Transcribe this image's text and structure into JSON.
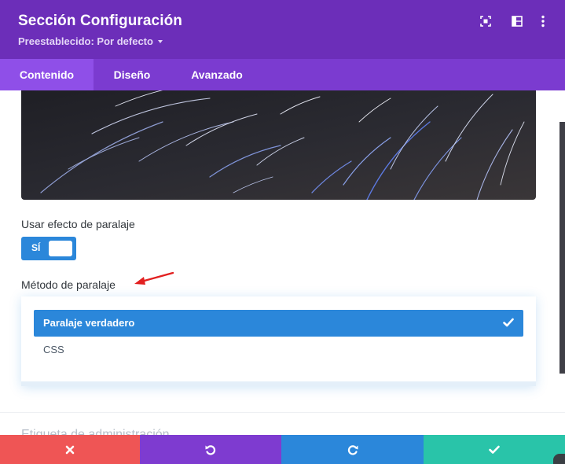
{
  "header": {
    "title": "Sección Configuración",
    "preset_label": "Preestablecido: Por defecto",
    "icons": [
      "focus-icon",
      "columns-icon",
      "more-vertical-icon"
    ]
  },
  "tabs": [
    {
      "label": "Contenido",
      "active": true
    },
    {
      "label": "Diseño",
      "active": false
    },
    {
      "label": "Avanzado",
      "active": false
    }
  ],
  "content": {
    "parallax_label": "Usar efecto de paralaje",
    "parallax_toggle": {
      "state_label": "SÍ",
      "on": true
    },
    "method_label": "Método de paralaje",
    "method_options": [
      {
        "label": "Paralaje verdadero",
        "selected": true
      },
      {
        "label": "CSS",
        "selected": false
      }
    ],
    "next_section_label": "Etiqueta de administración"
  },
  "footer": {
    "buttons": [
      {
        "icon": "close-icon",
        "color": "#ef5555"
      },
      {
        "icon": "undo-icon",
        "color": "#7e3bd0"
      },
      {
        "icon": "redo-icon",
        "color": "#2b87da"
      },
      {
        "icon": "check-icon",
        "color": "#29c4a9"
      }
    ]
  },
  "colors": {
    "header": "#6c2eb9",
    "tabs": "#7b3bd0",
    "active_tab": "#8f4fe8",
    "accent": "#2b87da"
  }
}
